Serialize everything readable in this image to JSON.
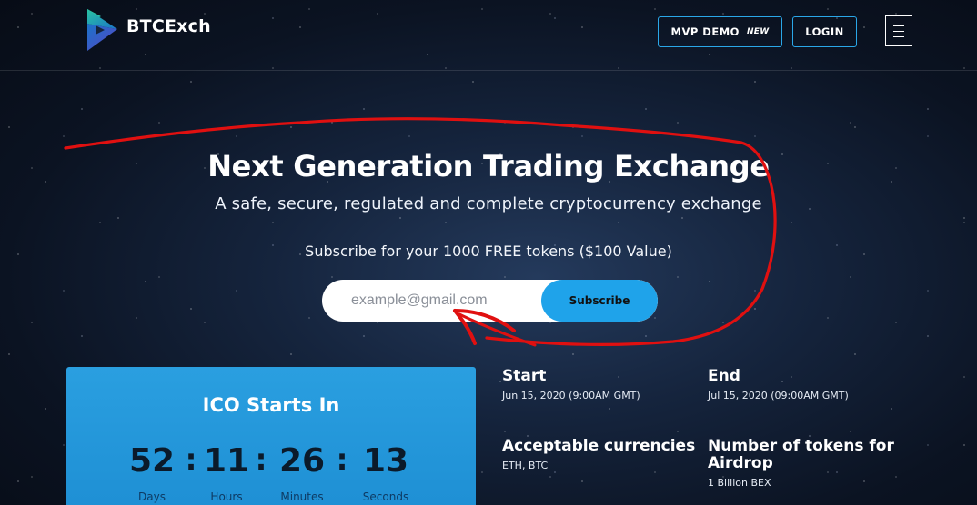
{
  "brand": {
    "name": "BTCExch",
    "logo_icon": "play-triangle-icon",
    "colors": [
      "#2ac3a2",
      "#1a73c9",
      "#5a44c4"
    ]
  },
  "header": {
    "demo_label": "MVP DEMO",
    "demo_badge": "NEW",
    "login_label": "LOGIN",
    "menu_icon": "hamburger-icon"
  },
  "hero": {
    "title": "Next Generation Trading Exchange",
    "subtitle": "A safe, secure, regulated and complete cryptocurrency exchange",
    "subscribe_text": "Subscribe for your 1000 FREE tokens ($100 Value)",
    "email_placeholder": "example@gmail.com",
    "subscribe_label": "Subscribe"
  },
  "ico": {
    "title": "ICO Starts In",
    "countdown": [
      {
        "value": "52",
        "label": "Days"
      },
      {
        "value": "11",
        "label": "Hours"
      },
      {
        "value": "26",
        "label": "Minutes"
      },
      {
        "value": "13",
        "label": "Seconds"
      }
    ],
    "separator": ":"
  },
  "info": {
    "start_title": "Start",
    "start_value": "Jun 15, 2020 (9:00AM GMT)",
    "end_title": "End",
    "end_value": "Jul 15, 2020 (09:00AM GMT)",
    "currencies_title": "Acceptable currencies",
    "currencies_value": "ETH, BTC",
    "airdrop_title": "Number of tokens for Airdrop",
    "airdrop_value": "1 Billion BEX"
  },
  "colors": {
    "accent": "#1fa3ea",
    "card": "#2a9fe0",
    "annotation": "#e01010"
  }
}
